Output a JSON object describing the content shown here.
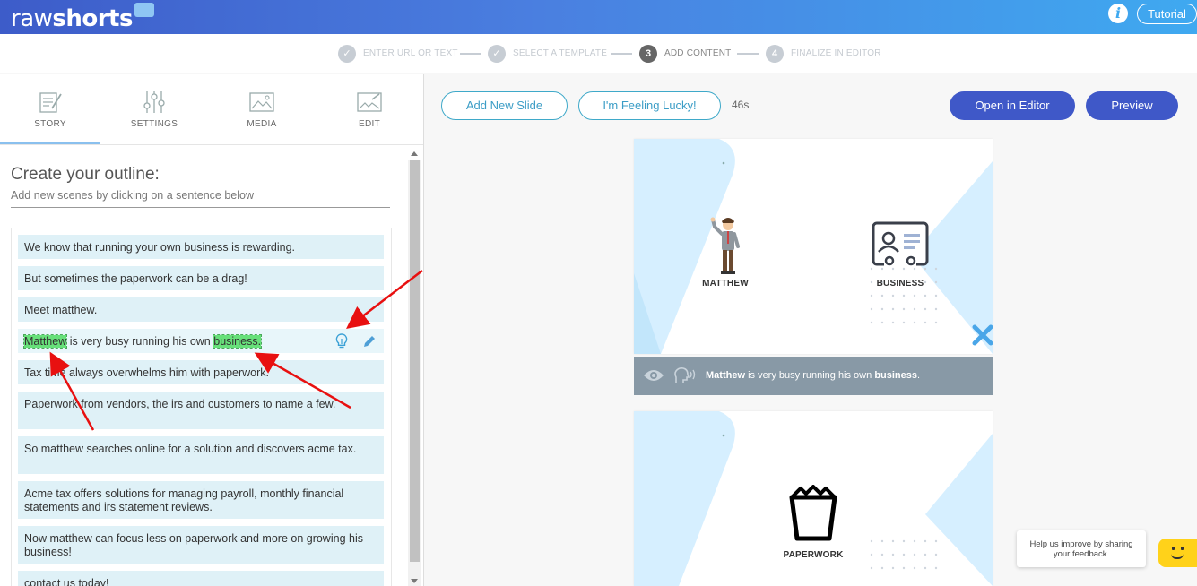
{
  "header": {
    "logo_regular": "raw",
    "logo_bold": "shorts",
    "info_label": "i",
    "tutorial_label": "Tutorial"
  },
  "steps": [
    {
      "num": "✓",
      "label": "ENTER URL OR TEXT",
      "state": "done"
    },
    {
      "num": "✓",
      "label": "SELECT A TEMPLATE",
      "state": "done"
    },
    {
      "num": "3",
      "label": "ADD CONTENT",
      "state": "active"
    },
    {
      "num": "4",
      "label": "FINALIZE IN EDITOR",
      "state": "pending"
    }
  ],
  "tabs": [
    {
      "label": "STORY",
      "icon": "story-icon"
    },
    {
      "label": "SETTINGS",
      "icon": "sliders-icon"
    },
    {
      "label": "MEDIA",
      "icon": "image-icon"
    },
    {
      "label": "EDIT",
      "icon": "edit-image-icon"
    }
  ],
  "outline": {
    "title": "Create your outline:",
    "subtitle": "Add new scenes by clicking on a sentence below",
    "sentences": [
      "We know that running your own business is rewarding.",
      "But sometimes the paperwork can be a drag!",
      "Meet matthew.",
      "is very busy running his own",
      "Tax time always overwhelms him with paperwork.",
      "Paperwork from vendors, the irs and customers to name a few.",
      "So matthew searches online for a solution and discovers acme tax.",
      "Acme tax offers solutions for managing payroll, monthly financial statements and irs statement reviews.",
      "Now matthew can focus less on paperwork and more on growing his business!",
      "contact us today!"
    ],
    "selected": {
      "keyword1": "Matthew",
      "middle": "is very busy running his own",
      "keyword2": "business."
    }
  },
  "toolbar": {
    "add_slide": "Add New Slide",
    "lucky": "I'm Feeling Lucky!",
    "duration": "46s",
    "open_editor": "Open in Editor",
    "preview": "Preview"
  },
  "slides": [
    {
      "labels": [
        "MATTHEW",
        "BUSINESS"
      ],
      "caption_bold1": "Matthew",
      "caption_mid": "is very busy running his own",
      "caption_bold2": "business",
      "caption_end": "."
    },
    {
      "labels": [
        "PAPERWORK"
      ]
    }
  ],
  "feedback": {
    "line1": "Help us improve by sharing",
    "line2": "your feedback."
  },
  "colors": {
    "header_start": "#3d5cc9",
    "header_end": "#3fa9f0",
    "primary_button": "#3f58c8",
    "sentence_bg": "#dff1f7",
    "keyword_highlight": "#67e07a",
    "annotation_arrow": "#e81010"
  }
}
